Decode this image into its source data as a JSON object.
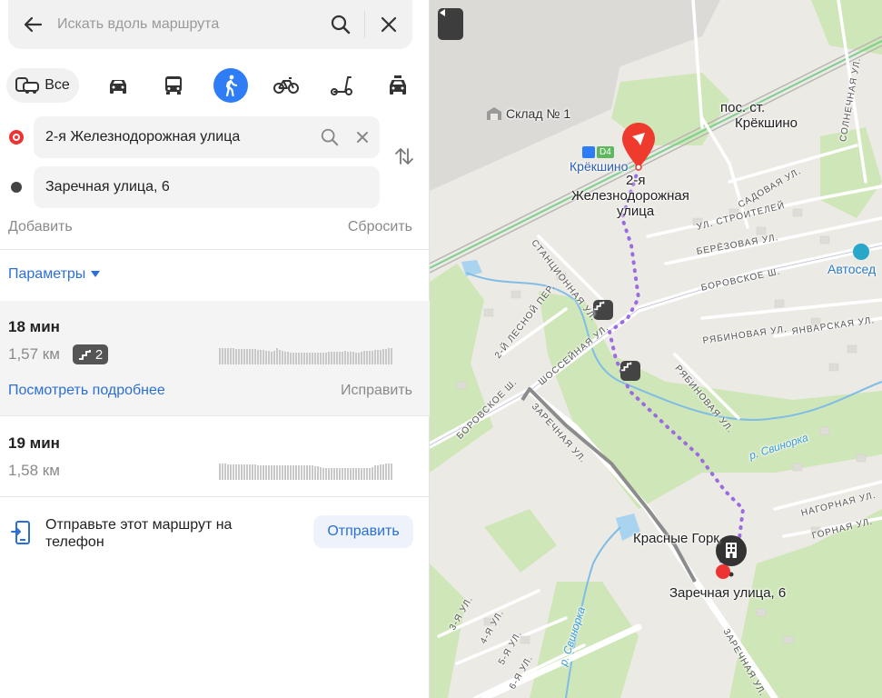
{
  "search": {
    "placeholder": "Искать вдоль маршрута"
  },
  "modes": {
    "all_label": "Все",
    "items": [
      "car-icon",
      "bus-icon",
      "pedestrian-icon",
      "bicycle-icon",
      "scooter-icon",
      "taxi-icon"
    ],
    "active": "pedestrian-icon"
  },
  "route_points": {
    "from": "2-я Железнодорожная улица",
    "to": "Заречная улица, 6",
    "add_label": "Добавить",
    "reset_label": "Сбросить"
  },
  "params_label": "Параметры",
  "routes": [
    {
      "time": "18 мин",
      "dist": "1,57 км",
      "stairs": "2",
      "more_label": "Посмотреть подробнее",
      "fix_label": "Исправить"
    },
    {
      "time": "19 мин",
      "dist": "1,58 км"
    }
  ],
  "send": {
    "text": "Отправьте этот маршрут на телефон",
    "button": "Отправить"
  },
  "map": {
    "labels": {
      "sklad": "Склад № 1",
      "pos_st_1": "пос. ст.",
      "pos_st_2": "Крёкшино",
      "kreksino": "Крёкшино",
      "d4": "D4",
      "start_1": "2-я",
      "start_2": "Железнодорожная",
      "start_3": "улица",
      "solnechnaya": "СОЛНЕЧНАЯ УЛ.",
      "sadovaya": "САДОВАЯ УЛ.",
      "stroiteley": "УЛ. СТРОИТЕЛЕЙ",
      "berezovaya": "БЕРЁЗОВАЯ УЛ.",
      "avtoserv": "Автосед",
      "borovskoe_top": "БОРОВСКОЕ Ш.",
      "stantsionnaya": "СТАНЦИОННАЯ УЛ.",
      "lesnoy": "2-Й ЛЕСНОЙ ПЕР.",
      "shosseynaya": "ШОССЕЙНАЯ УЛ.",
      "yanvarskaya": "ЯНВАРСКАЯ УЛ.",
      "ryabinovaya_h": "РЯБИНОВАЯ УЛ.",
      "ryabinovaya_v": "РЯБИНОВАЯ УЛ.",
      "borovskoe_left": "БОРОВСКОЕ Ш.",
      "zarechnaya_left": "ЗАРЕЧНАЯ УЛ.",
      "svinorka_r": "р. Свинорка",
      "nagornaya": "НАГОРНАЯ УЛ.",
      "gornaya": "ГОРНАЯ УЛ.",
      "krasnye_gory": "Красные Горк",
      "end_label": "Заречная улица, 6",
      "ul3": "3-Я УЛ.",
      "ul4": "4-Я УЛ.",
      "ul5": "5-Я УЛ.",
      "ul6": "6-Я УЛ.",
      "svinorka_b": "р. Свинорка",
      "zarechnaya_bottom": "ЗАРЕЧНАЯ УЛ."
    }
  },
  "colors": {
    "accent": "#2f7df6",
    "route": "#9b6be0",
    "start_pin": "#ee3b2d"
  }
}
